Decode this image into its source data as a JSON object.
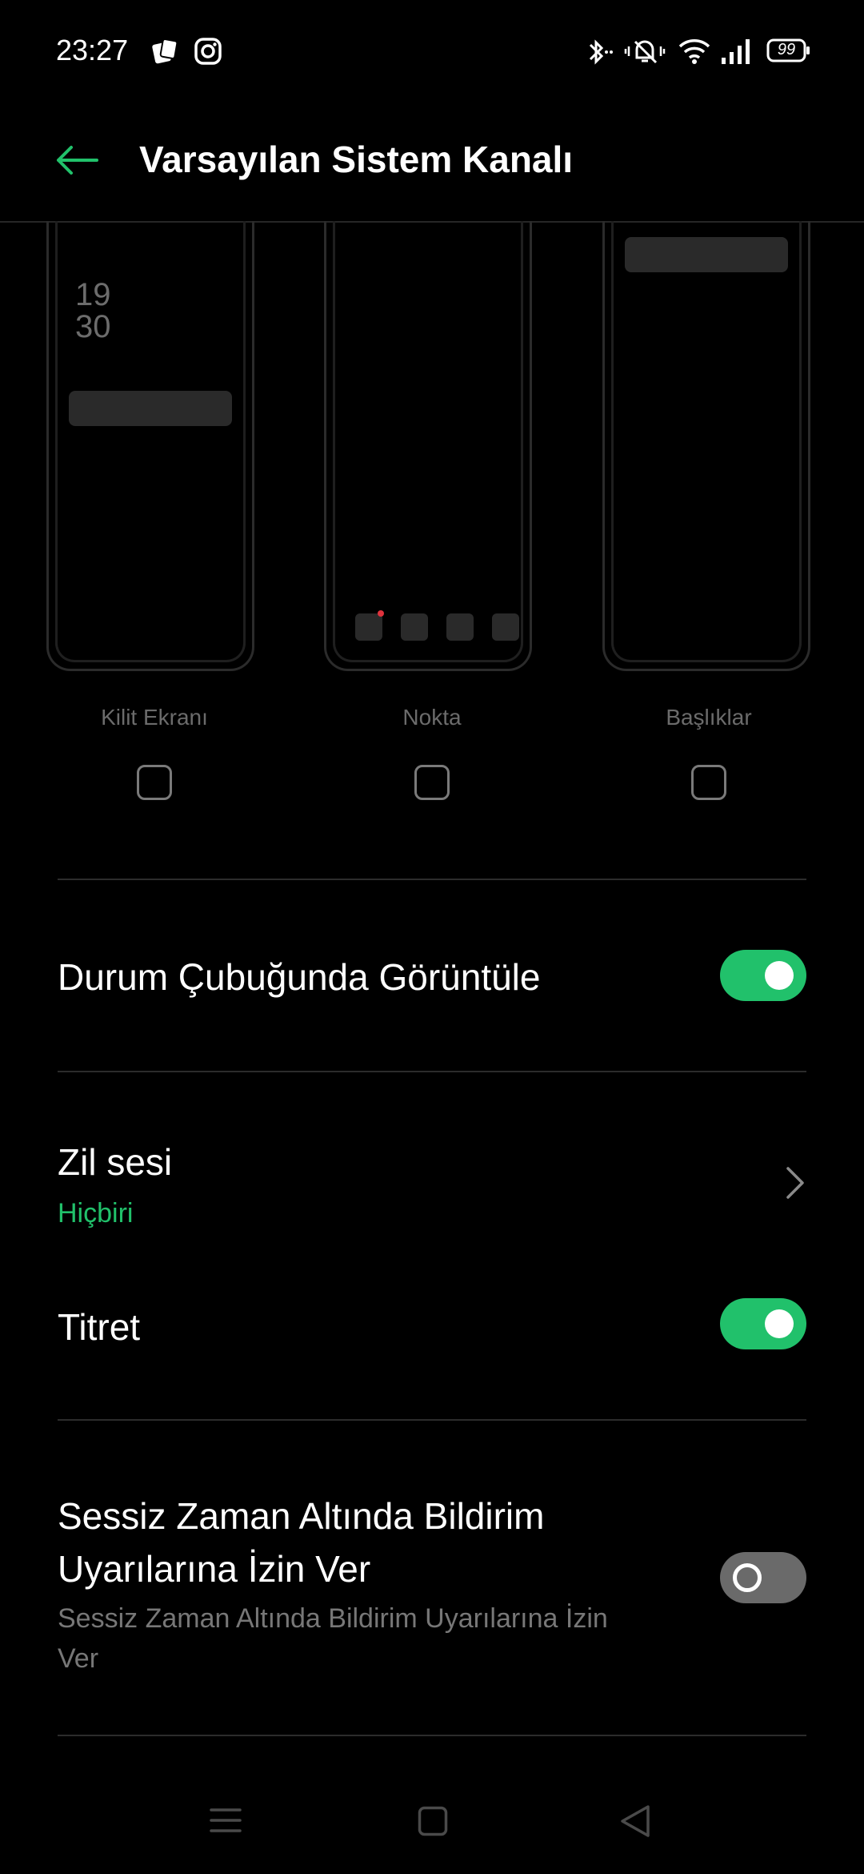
{
  "status_bar": {
    "time": "23:27",
    "battery": "99",
    "left_icons": [
      "game-app-icon",
      "instagram-icon"
    ],
    "right_icons": [
      "bluetooth-icon",
      "vibrate-silent-icon",
      "wifi-icon",
      "signal-icon",
      "battery-icon"
    ]
  },
  "app_bar": {
    "title": "Varsayılan Sistem Kanalı",
    "back_icon": "arrow-left-icon"
  },
  "previews": [
    {
      "label": "Kilit Ekranı",
      "clock_hour": "19",
      "clock_minute": "30",
      "checked": false
    },
    {
      "label": "Nokta",
      "checked": false
    },
    {
      "label": "Başlıklar",
      "checked": false
    }
  ],
  "settings": {
    "status_bar_display": {
      "label": "Durum Çubuğunda Görüntüle",
      "enabled": true
    },
    "ringtone": {
      "label": "Zil sesi",
      "value": "Hiçbiri"
    },
    "vibrate": {
      "label": "Titret",
      "enabled": true
    },
    "quiet_time": {
      "label_line1": "Sessiz Zaman Altında Bildirim",
      "label_line2": "Uyarılarına İzin Ver",
      "description_line1": "Sessiz Zaman Altında Bildirim Uyarılarına İzin",
      "description_line2": "Ver",
      "enabled": false
    }
  },
  "colors": {
    "accent": "#21c16b",
    "background": "#000000",
    "dot_red": "#e0333d"
  },
  "nav_bar": [
    "menu-icon",
    "home-icon",
    "back-triangle-icon"
  ]
}
